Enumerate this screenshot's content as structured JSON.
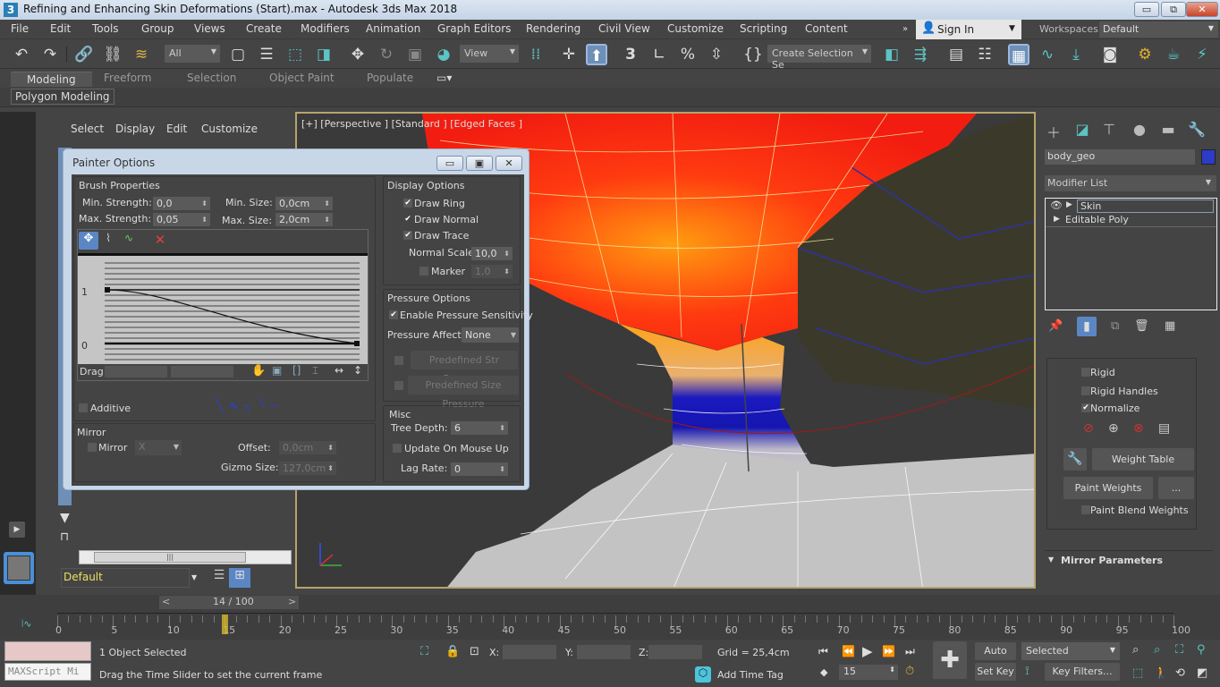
{
  "window": {
    "title": "Refining and Enhancing Skin Deformations (Start).max - Autodesk 3ds Max 2018",
    "app_icon": "3",
    "controls": {
      "minimize": "▭",
      "restore": "⧉",
      "close": "✕"
    }
  },
  "menubar": {
    "items": [
      "File",
      "Edit",
      "Tools",
      "Group",
      "Views",
      "Create",
      "Modifiers",
      "Animation",
      "Graph Editors",
      "Rendering",
      "Civil View",
      "Customize",
      "Scripting",
      "Content"
    ],
    "overflow": "»",
    "sign_in": "Sign In",
    "workspaces_label": "Workspaces:",
    "workspaces_value": "Default"
  },
  "toolbar": {
    "selection_filter": "All",
    "reference_coord": "View",
    "named_selection": "Create Selection Se",
    "icons": [
      "undo-icon",
      "redo-icon",
      "link-icon",
      "unlink-icon",
      "bind-space-warp-icon",
      "select-object-icon",
      "select-by-name-icon",
      "rect-selection-icon",
      "window-crossing-icon",
      "move-icon",
      "rotate-icon",
      "scale-icon",
      "select-manipulate-icon",
      "pivot-icon",
      "keyboard-shortcut-icon",
      "snap-3d-icon",
      "angle-snap-icon",
      "percent-snap-icon",
      "spinner-snap-icon",
      "edit-named-sel-icon",
      "mirror-icon",
      "align-icon",
      "scene-explorer-icon",
      "layer-explorer-icon",
      "ribbon-toggle-icon",
      "curve-editor-icon",
      "schematic-icon",
      "material-editor-icon",
      "render-setup-icon",
      "rendered-frame-icon",
      "render-icon"
    ]
  },
  "ribbon": {
    "tabs": [
      "Modeling",
      "Freeform",
      "Selection",
      "Object Paint",
      "Populate"
    ],
    "active_tab": "Modeling",
    "sub_label": "Polygon Modeling"
  },
  "scene_explorer": {
    "menu": [
      "Select",
      "Display",
      "Edit",
      "Customize"
    ],
    "layer": "Default"
  },
  "viewport": {
    "label": "[+] [Perspective ] [Standard ] [Edged Faces ]"
  },
  "painter_options": {
    "title": "Painter Options",
    "brush_properties": {
      "heading": "Brush Properties",
      "min_strength_label": "Min. Strength:",
      "min_strength": "0,0",
      "max_strength_label": "Max. Strength:",
      "max_strength": "0,05",
      "min_size_label": "Min. Size:",
      "min_size": "0,0cm",
      "max_size_label": "Max. Size:",
      "max_size": "2,0cm",
      "curve_y_labels": [
        "1",
        "0"
      ],
      "drag_label": "Drag",
      "additive_label": "Additive",
      "additive_checked": false
    },
    "mirror": {
      "heading": "Mirror",
      "mirror_label": "Mirror",
      "mirror_checked": false,
      "axis": "X",
      "offset_label": "Offset:",
      "offset": "0,0cm",
      "gizmo_size_label": "Gizmo Size:",
      "gizmo_size": "127,0cm"
    },
    "display_options": {
      "heading": "Display Options",
      "draw_ring": "Draw Ring",
      "draw_normal": "Draw Normal",
      "draw_trace": "Draw Trace",
      "normal_scale_label": "Normal Scale:",
      "normal_scale": "10,0",
      "marker_label": "Marker",
      "marker": "1,0"
    },
    "pressure_options": {
      "heading": "Pressure Options",
      "enable_label": "Enable Pressure Sensitivity",
      "affects_label": "Pressure Affects",
      "affects_value": "None",
      "predefined_str": "Predefined Str Pressure",
      "predefined_size": "Predefined Size Pressure"
    },
    "misc": {
      "heading": "Misc",
      "tree_depth_label": "Tree Depth:",
      "tree_depth": "6",
      "update_label": "Update On Mouse Up",
      "lag_rate_label": "Lag Rate:",
      "lag_rate": "0"
    }
  },
  "command_panel": {
    "object_name": "body_geo",
    "object_color": "#2c3cc8",
    "modifier_list": "Modifier List",
    "stack": [
      "Skin",
      "Editable Poly"
    ],
    "rigid": "Rigid",
    "rigid_handles": "Rigid Handles",
    "normalize": "Normalize",
    "weight_table": "Weight Table",
    "paint_weights": "Paint Weights",
    "ellipsis": "...",
    "paint_blend_weights": "Paint Blend Weights",
    "mirror_parameters": "Mirror Parameters"
  },
  "timeline": {
    "frame_display": "14 / 100",
    "prev": "<",
    "next": ">",
    "ticks": [
      "0",
      "5",
      "10",
      "15",
      "20",
      "25",
      "30",
      "35",
      "40",
      "45",
      "50",
      "55",
      "60",
      "65",
      "70",
      "75",
      "80",
      "85",
      "90",
      "95",
      "100"
    ],
    "current_frame": 15,
    "total_frames": 100
  },
  "status": {
    "maxscript": "MAXScript Mi",
    "selected": "1 Object Selected",
    "prompt": "Drag the Time Slider to set the current frame",
    "x_label": "X:",
    "y_label": "Y:",
    "z_label": "Z:",
    "grid": "Grid = 25,4cm",
    "add_time_tag": "Add Time Tag",
    "frame_field": "15",
    "auto_key": "Auto Key",
    "set_key": "Set Key",
    "key_mode": "Selected",
    "key_filters": "Key Filters..."
  }
}
